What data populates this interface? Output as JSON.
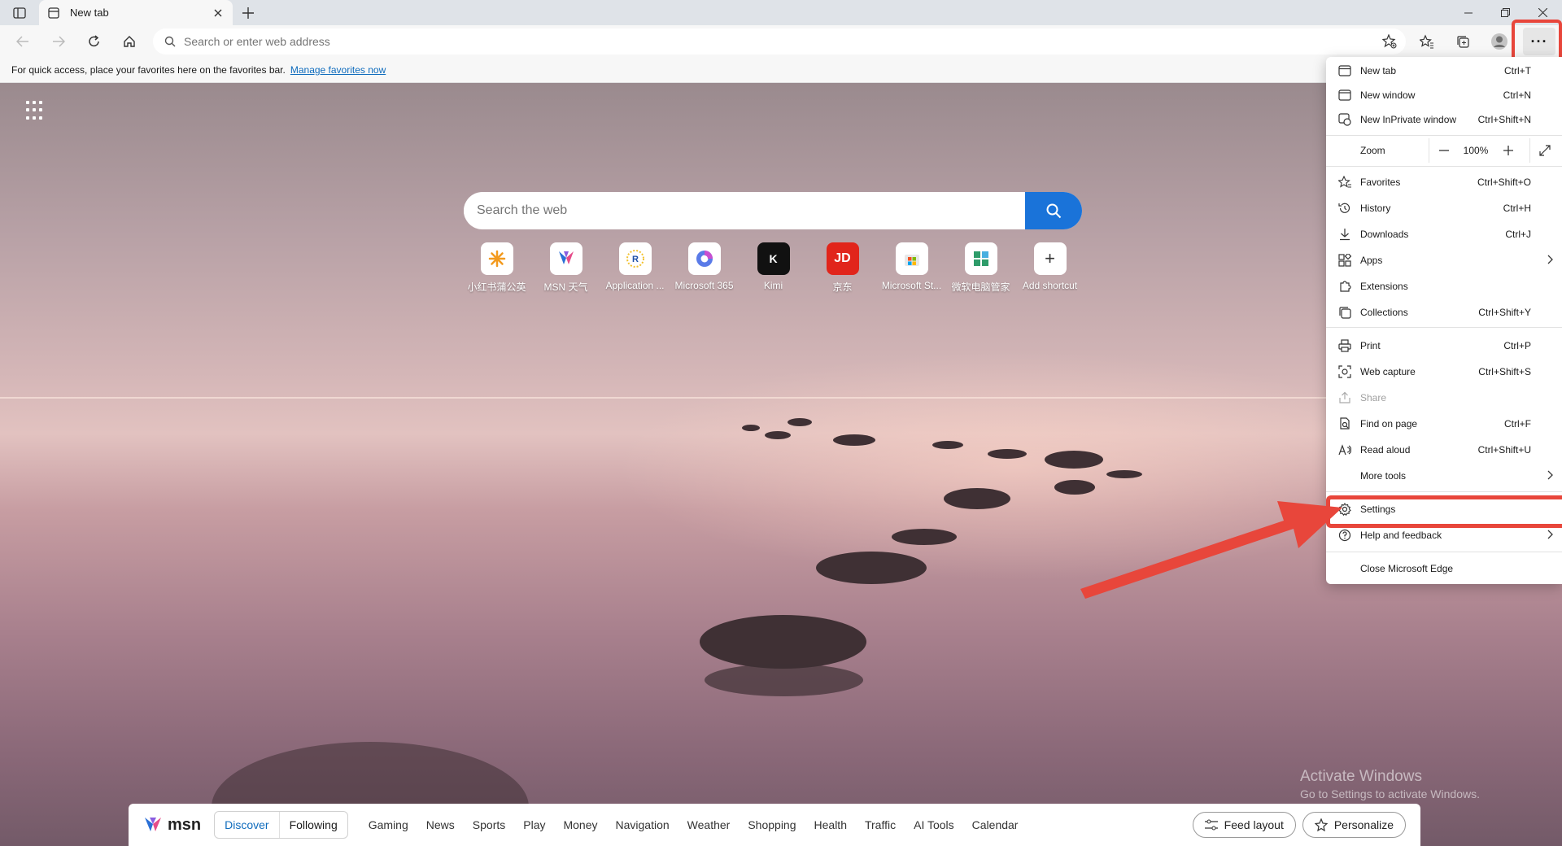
{
  "browser": {
    "tab": {
      "title": "New tab"
    },
    "address": {
      "placeholder": "Search or enter web address"
    },
    "favorites_bar": {
      "message": "For quick access, place your favorites here on the favorites bar.",
      "link": "Manage favorites now"
    },
    "more_button": "···"
  },
  "newtab": {
    "search_placeholder": "Search the web",
    "shortcuts": [
      {
        "label": "小红书蒲公英",
        "icon": "xiaohongshu-icon"
      },
      {
        "label": "MSN 天气",
        "icon": "msn-weather-icon"
      },
      {
        "label": "Application ...",
        "icon": "application-icon"
      },
      {
        "label": "Microsoft 365",
        "icon": "microsoft-365-icon"
      },
      {
        "label": "Kimi",
        "icon": "kimi-icon",
        "glyph": "K"
      },
      {
        "label": "京东",
        "icon": "jd-icon",
        "glyph": "JD"
      },
      {
        "label": "Microsoft St...",
        "icon": "microsoft-store-icon"
      },
      {
        "label": "微软电脑管家",
        "icon": "pc-manager-icon"
      },
      {
        "label": "Add shortcut",
        "icon": "plus-icon",
        "glyph": "+"
      }
    ],
    "watermark": {
      "title": "Activate Windows",
      "subtitle": "Go to Settings to activate Windows."
    }
  },
  "msn": {
    "logo": "msn",
    "tabs": [
      "Discover",
      "Following"
    ],
    "nav": [
      "Gaming",
      "News",
      "Sports",
      "Play",
      "Money",
      "Navigation",
      "Weather",
      "Shopping",
      "Health",
      "Traffic",
      "AI Tools",
      "Calendar"
    ],
    "feed_layout": "Feed layout",
    "personalize": "Personalize"
  },
  "menu": {
    "items": [
      {
        "label": "New tab",
        "shortcut": "Ctrl+T",
        "icon": "new-tab-icon"
      },
      {
        "label": "New window",
        "shortcut": "Ctrl+N",
        "icon": "new-window-icon"
      },
      {
        "label": "New InPrivate window",
        "shortcut": "Ctrl+Shift+N",
        "icon": "inprivate-icon"
      },
      {
        "label": "Zoom",
        "zoom_value": "100%"
      },
      {
        "label": "Favorites",
        "shortcut": "Ctrl+Shift+O",
        "icon": "favorites-icon"
      },
      {
        "label": "History",
        "shortcut": "Ctrl+H",
        "icon": "history-icon"
      },
      {
        "label": "Downloads",
        "shortcut": "Ctrl+J",
        "icon": "downloads-icon"
      },
      {
        "label": "Apps",
        "shortcut": "",
        "icon": "apps-icon"
      },
      {
        "label": "Extensions",
        "shortcut": "",
        "icon": "extensions-icon"
      },
      {
        "label": "Collections",
        "shortcut": "Ctrl+Shift+Y",
        "icon": "collections-icon"
      },
      {
        "label": "Print",
        "shortcut": "Ctrl+P",
        "icon": "print-icon"
      },
      {
        "label": "Web capture",
        "shortcut": "Ctrl+Shift+S",
        "icon": "web-capture-icon"
      },
      {
        "label": "Share",
        "shortcut": "",
        "icon": "share-icon"
      },
      {
        "label": "Find on page",
        "shortcut": "Ctrl+F",
        "icon": "find-icon"
      },
      {
        "label": "Read aloud",
        "shortcut": "Ctrl+Shift+U",
        "icon": "read-aloud-icon"
      },
      {
        "label": "More tools",
        "shortcut": "",
        "icon": "more-tools-icon"
      },
      {
        "label": "Settings",
        "shortcut": "",
        "icon": "gear-icon"
      },
      {
        "label": "Help and feedback",
        "shortcut": "",
        "icon": "help-icon"
      },
      {
        "label": "Close Microsoft Edge",
        "shortcut": ""
      }
    ]
  },
  "colors": {
    "accent": "#0f6cbd",
    "highlight": "#e8463b",
    "search_button": "#1a73d9"
  }
}
